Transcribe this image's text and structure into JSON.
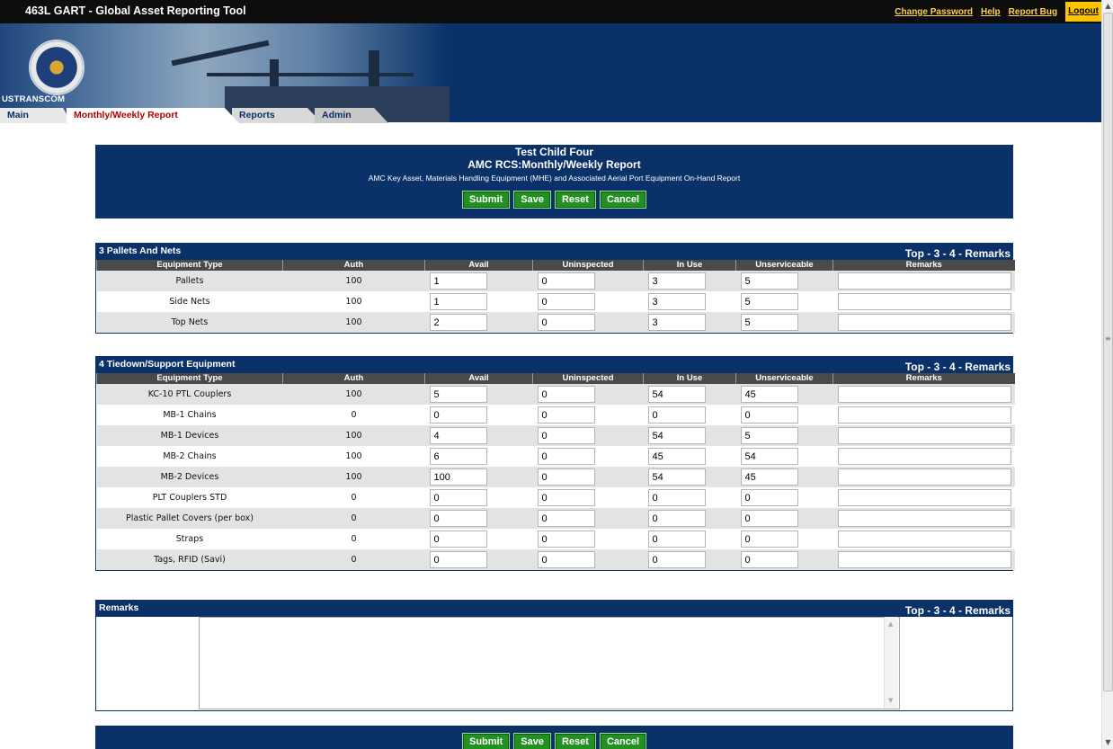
{
  "app": {
    "title": "463L GART - Global Asset Reporting Tool",
    "brand": "USTRANSCOM",
    "links": [
      "Change Password",
      "Help",
      "Report Bug",
      "Logout"
    ]
  },
  "tabs": [
    "Main",
    "Monthly/Weekly Report",
    "Reports",
    "Admin"
  ],
  "header": {
    "title1": "Test Child Four",
    "title2": "AMC RCS:Monthly/Weekly Report",
    "subtitle": "AMC Key Asset, Materials Handling Equipment (MHE) and Associated Aerial Port Equipment On-Hand Report"
  },
  "buttons": {
    "submit": "Submit",
    "save": "Save",
    "reset": "Reset",
    "cancel": "Cancel"
  },
  "columns": [
    "Equipment Type",
    "Auth",
    "Avail",
    "Uninspected",
    "In Use",
    "Unserviceable",
    "Remarks"
  ],
  "nav_text": "Top - 3 - 4 - Remarks",
  "sections": {
    "pallets": {
      "title": "3 Pallets And Nets",
      "rows": [
        {
          "type": "Pallets",
          "auth": "100",
          "avail": "1",
          "uninspected": "0",
          "inuse": "3",
          "unserviceable": "5",
          "remarks": ""
        },
        {
          "type": "Side Nets",
          "auth": "100",
          "avail": "1",
          "uninspected": "0",
          "inuse": "3",
          "unserviceable": "5",
          "remarks": ""
        },
        {
          "type": "Top Nets",
          "auth": "100",
          "avail": "2",
          "uninspected": "0",
          "inuse": "3",
          "unserviceable": "5",
          "remarks": ""
        }
      ]
    },
    "tiedown": {
      "title": "4 Tiedown/Support Equipment",
      "rows": [
        {
          "type": "KC-10 PTL Couplers",
          "auth": "100",
          "avail": "5",
          "uninspected": "0",
          "inuse": "54",
          "unserviceable": "45",
          "remarks": ""
        },
        {
          "type": "MB-1 Chains",
          "auth": "0",
          "avail": "0",
          "uninspected": "0",
          "inuse": "0",
          "unserviceable": "0",
          "remarks": ""
        },
        {
          "type": "MB-1 Devices",
          "auth": "100",
          "avail": "4",
          "uninspected": "0",
          "inuse": "54",
          "unserviceable": "5",
          "remarks": ""
        },
        {
          "type": "MB-2 Chains",
          "auth": "100",
          "avail": "6",
          "uninspected": "0",
          "inuse": "45",
          "unserviceable": "54",
          "remarks": ""
        },
        {
          "type": "MB-2 Devices",
          "auth": "100",
          "avail": "100",
          "uninspected": "0",
          "inuse": "54",
          "unserviceable": "45",
          "remarks": ""
        },
        {
          "type": "PLT Couplers STD",
          "auth": "0",
          "avail": "0",
          "uninspected": "0",
          "inuse": "0",
          "unserviceable": "0",
          "remarks": ""
        },
        {
          "type": "Plastic Pallet Covers (per box)",
          "auth": "0",
          "avail": "0",
          "uninspected": "0",
          "inuse": "0",
          "unserviceable": "0",
          "remarks": ""
        },
        {
          "type": "Straps",
          "auth": "0",
          "avail": "0",
          "uninspected": "0",
          "inuse": "0",
          "unserviceable": "0",
          "remarks": ""
        },
        {
          "type": "Tags, RFID (Savi)",
          "auth": "0",
          "avail": "0",
          "uninspected": "0",
          "inuse": "0",
          "unserviceable": "0",
          "remarks": ""
        }
      ]
    },
    "remarks": {
      "title": "Remarks",
      "text": ""
    }
  }
}
